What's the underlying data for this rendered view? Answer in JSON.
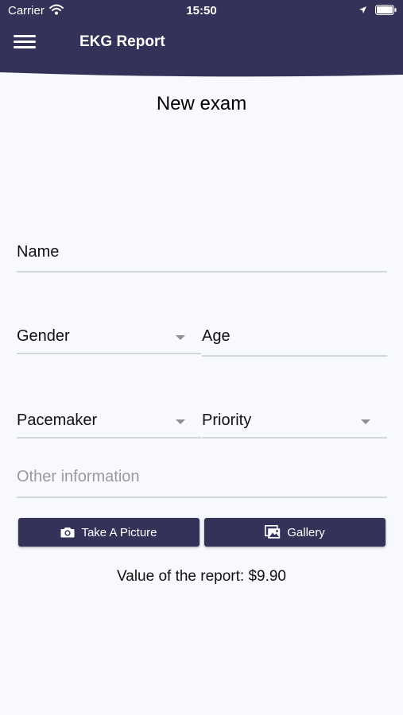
{
  "colors": {
    "header": "#35325a",
    "background": "#f8f9fc",
    "button": "#35325a",
    "underline": "#d3d6dc"
  },
  "status_bar": {
    "carrier": "Carrier",
    "time": "15:50",
    "icons": [
      "wifi-icon",
      "location-icon",
      "battery-icon"
    ]
  },
  "header": {
    "menu_icon": "hamburger-menu-icon",
    "title": "EKG Report"
  },
  "page": {
    "title": "New exam"
  },
  "form": {
    "name_label": "Name",
    "gender_label": "Gender",
    "age_label": "Age",
    "pacemaker_label": "Pacemaker",
    "priority_label": "Priority",
    "other_placeholder": "Other information"
  },
  "actions": {
    "take_picture_label": "Take A Picture",
    "take_picture_icon": "camera-icon",
    "gallery_label": "Gallery",
    "gallery_icon": "gallery-icon"
  },
  "report": {
    "value_text": "Value of the report: $9.90"
  }
}
